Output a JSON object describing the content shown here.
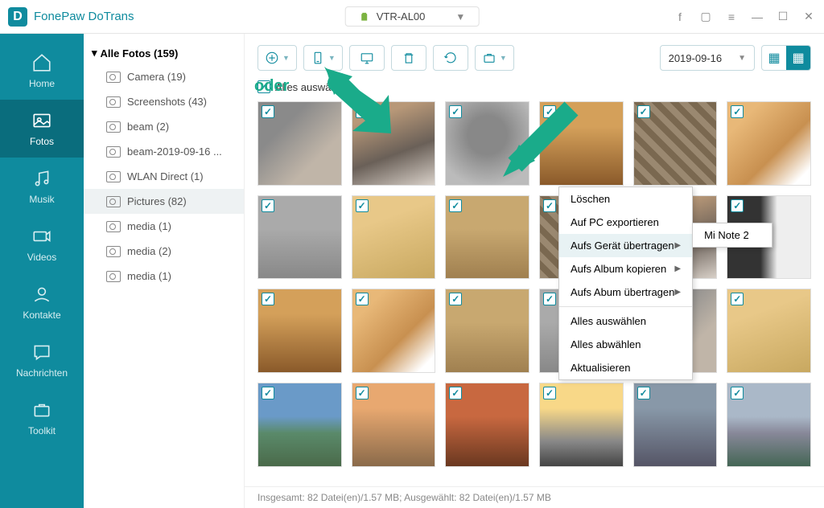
{
  "app": {
    "title": "FonePaw DoTrans"
  },
  "device": {
    "name": "VTR-AL00"
  },
  "nav": {
    "home": "Home",
    "fotos": "Fotos",
    "musik": "Musik",
    "videos": "Videos",
    "kontakte": "Kontakte",
    "nachrichten": "Nachrichten",
    "toolkit": "Toolkit"
  },
  "folders": {
    "root": "Alle Fotos (159)",
    "items": [
      {
        "label": "Camera (19)"
      },
      {
        "label": "Screenshots (43)"
      },
      {
        "label": "beam (2)"
      },
      {
        "label": "beam-2019-09-16 ..."
      },
      {
        "label": "WLAN Direct (1)"
      },
      {
        "label": "Pictures (82)"
      },
      {
        "label": "media (1)"
      },
      {
        "label": "media (2)"
      },
      {
        "label": "media (1)"
      }
    ]
  },
  "toolbar": {
    "date": "2019-09-16"
  },
  "selectAll": {
    "label": "Alles auswählen"
  },
  "annotation": {
    "oder": "oder"
  },
  "context": {
    "delete": "Löschen",
    "exportPC": "Auf PC exportieren",
    "toDevice": "Aufs Gerät übertragen",
    "toAlbum": "Aufs Album kopieren",
    "toAlbumMove": "Aufs Abum übertragen",
    "selectAll": "Alles auswählen",
    "deselectAll": "Alles abwählen",
    "refresh": "Aktualisieren",
    "subDevice": "Mi Note 2"
  },
  "status": {
    "text": "Insgesamt: 82 Datei(en)/1.57 MB; Ausgewählt: 82 Datei(en)/1.57 MB"
  }
}
